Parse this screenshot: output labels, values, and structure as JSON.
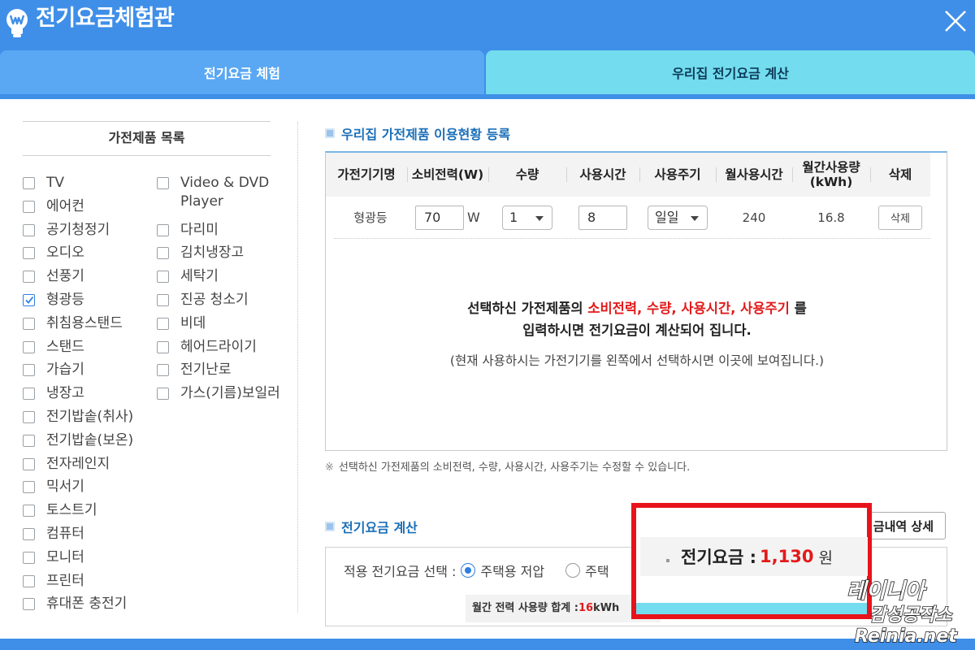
{
  "window": {
    "title": "전기요금체험관"
  },
  "tabs": [
    {
      "label": "전기요금 체험",
      "active": false
    },
    {
      "label": "우리집 전기요금 계산",
      "active": true
    }
  ],
  "sidebar": {
    "title": "가전제품 목록",
    "left_items": [
      {
        "label": "TV",
        "checked": false
      },
      {
        "label": "에어컨",
        "checked": false
      },
      {
        "label": "공기청정기",
        "checked": false
      },
      {
        "label": "오디오",
        "checked": false
      },
      {
        "label": "선풍기",
        "checked": false
      },
      {
        "label": "형광등",
        "checked": true
      },
      {
        "label": "취침용스탠드",
        "checked": false
      },
      {
        "label": "스탠드",
        "checked": false
      },
      {
        "label": "가습기",
        "checked": false
      },
      {
        "label": "냉장고",
        "checked": false
      },
      {
        "label": "전기밥솥(취사)",
        "checked": false
      },
      {
        "label": "전기밥솥(보온)",
        "checked": false
      },
      {
        "label": "전자레인지",
        "checked": false
      },
      {
        "label": "믹서기",
        "checked": false
      },
      {
        "label": "토스트기",
        "checked": false
      },
      {
        "label": "컴퓨터",
        "checked": false
      },
      {
        "label": "모니터",
        "checked": false
      },
      {
        "label": "프린터",
        "checked": false
      },
      {
        "label": "휴대폰 충전기",
        "checked": false
      }
    ],
    "right_items": [
      {
        "label": "Video & DVD Player",
        "checked": false
      },
      {
        "label": "다리미",
        "checked": false
      },
      {
        "label": "김치냉장고",
        "checked": false
      },
      {
        "label": "세탁기",
        "checked": false
      },
      {
        "label": "진공 청소기",
        "checked": false
      },
      {
        "label": "비데",
        "checked": false
      },
      {
        "label": "헤어드라이기",
        "checked": false
      },
      {
        "label": "전기난로",
        "checked": false
      },
      {
        "label": "가스(기름)보일러",
        "checked": false
      }
    ]
  },
  "registration": {
    "heading": "우리집 가전제품 이용현황 등록",
    "columns": [
      "가전기기명",
      "소비전력(W)",
      "수량",
      "사용시간",
      "사용주기",
      "월사용시간",
      "월간사용량 (kWh)",
      "삭제"
    ],
    "row": {
      "name": "형광등",
      "power": "70",
      "power_unit": "W",
      "quantity": "1",
      "hours": "8",
      "cycle": "일일",
      "monthly_hours": "240",
      "monthly_kwh": "16.8",
      "delete_label": "삭제"
    },
    "notice_line1_prefix": "선택하신 가전제품의 ",
    "notice_line1_highlight": "소비전력, 수량, 사용시간, 사용주기",
    "notice_line1_suffix": " 를",
    "notice_line2": "입력하시면 전기요금이 계산되어 집니다.",
    "notice_line3": "(현재 사용하시는 가전기기를 왼쪽에서 선택하시면 이곳에 보여집니다.)",
    "footnote_mark": "※",
    "footnote": "선택하신 가전제품의 소비전력, 수량, 사용시간, 사용주기는 수정할 수 있습니다."
  },
  "fee": {
    "heading": "전기요금 계산",
    "detail_button": "금내역 상세",
    "select_label": "적용 전기요금 선택 :",
    "option_low": "주택용 저압",
    "option_high_partial": "주택",
    "monthly_label": "월간 전력 사용량 합계 :",
    "monthly_value": "16",
    "monthly_unit": "kWh",
    "result_label": "전기요금 :",
    "result_value": "1,130",
    "result_unit": "원"
  },
  "watermark": {
    "line1": "레이니아",
    "line2": "감성공작소",
    "line3": "Reinia.net"
  },
  "colors": {
    "header_blue": "#3f8fe8",
    "tab_inactive": "#5aa8f3",
    "tab_active": "#73dcef",
    "highlight_red": "#e8131a",
    "value_red": "#e21a1a",
    "heading_blue": "#1b6fb8"
  },
  "icons": {
    "logo": "lightbulb-w-icon",
    "close": "close-icon",
    "check": "checkmark-icon",
    "dropdown": "caret-down-icon"
  }
}
